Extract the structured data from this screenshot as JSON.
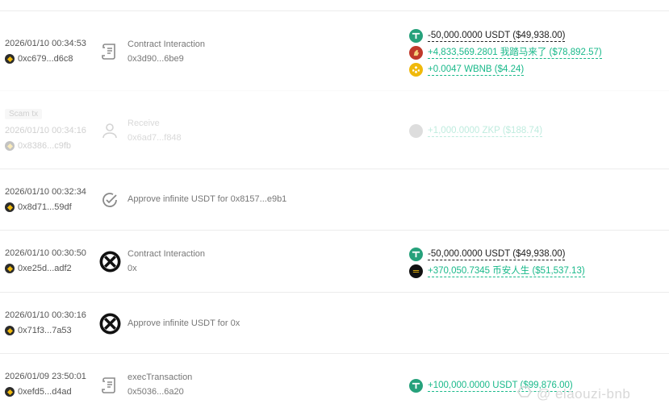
{
  "colors": {
    "positive": "#19b98a",
    "negative": "#222222",
    "tether": "#26a17b",
    "bnb": "#f0b90b"
  },
  "transactions": [
    {
      "time": "2026/01/10 00:34:53",
      "address": "0xc679...d6c8",
      "type_icon": "contract-scroll-icon",
      "type_title": "Contract Interaction",
      "type_sub": "0x3d90...6be9",
      "changes": [
        {
          "token_icon": "usdt-icon",
          "text": "-50,000.0000 USDT ($49,938.00)",
          "direction": "out"
        },
        {
          "token_icon": "horse-token-icon",
          "text": "+4,833,569.2801 我踏马来了 ($78,892.57)",
          "direction": "in"
        },
        {
          "token_icon": "bnb-icon",
          "text": "+0.0047 WBNB ($4.24)",
          "direction": "in"
        }
      ]
    },
    {
      "badge": "Scam tx",
      "time": "2026/01/10 00:34:16",
      "address": "0x8386...c9fb",
      "type_icon": "user-receive-icon",
      "type_title": "Receive",
      "type_sub": "0x6ad7...f848",
      "changes": [
        {
          "token_icon": "zkp-token-icon",
          "text": "+1,000.0000 ZKP ($188.74)",
          "direction": "in"
        }
      ]
    },
    {
      "time": "2026/01/10 00:32:34",
      "address": "0x8d71...59df",
      "type_icon": "approve-check-icon",
      "type_title": "Approve infinite USDT for 0x8157...e9b1",
      "type_sub": "",
      "changes": []
    },
    {
      "time": "2026/01/10 00:30:50",
      "address": "0xe25d...adf2",
      "type_icon": "swap-protocol-icon",
      "type_title": "Contract Interaction",
      "type_sub": "0x",
      "changes": [
        {
          "token_icon": "usdt-icon",
          "text": "-50,000.0000 USDT ($49,938.00)",
          "direction": "out"
        },
        {
          "token_icon": "binance-life-token-icon",
          "text": "+370,050.7345 币安人生 ($51,537.13)",
          "direction": "in"
        }
      ]
    },
    {
      "time": "2026/01/10 00:30:16",
      "address": "0x71f3...7a53",
      "type_icon": "swap-protocol-icon",
      "type_title": "Approve infinite USDT for 0x",
      "type_sub": "",
      "changes": []
    },
    {
      "time": "2026/01/09 23:50:01",
      "address": "0xefd5...d4ad",
      "type_icon": "contract-scroll-icon",
      "type_title": "execTransaction",
      "type_sub": "0x5036...6a20",
      "changes": [
        {
          "token_icon": "usdt-icon",
          "text": "+100,000.0000 USDT ($99,876.00)",
          "direction": "in"
        }
      ]
    }
  ],
  "watermark": "@ elaouzi-bnb"
}
